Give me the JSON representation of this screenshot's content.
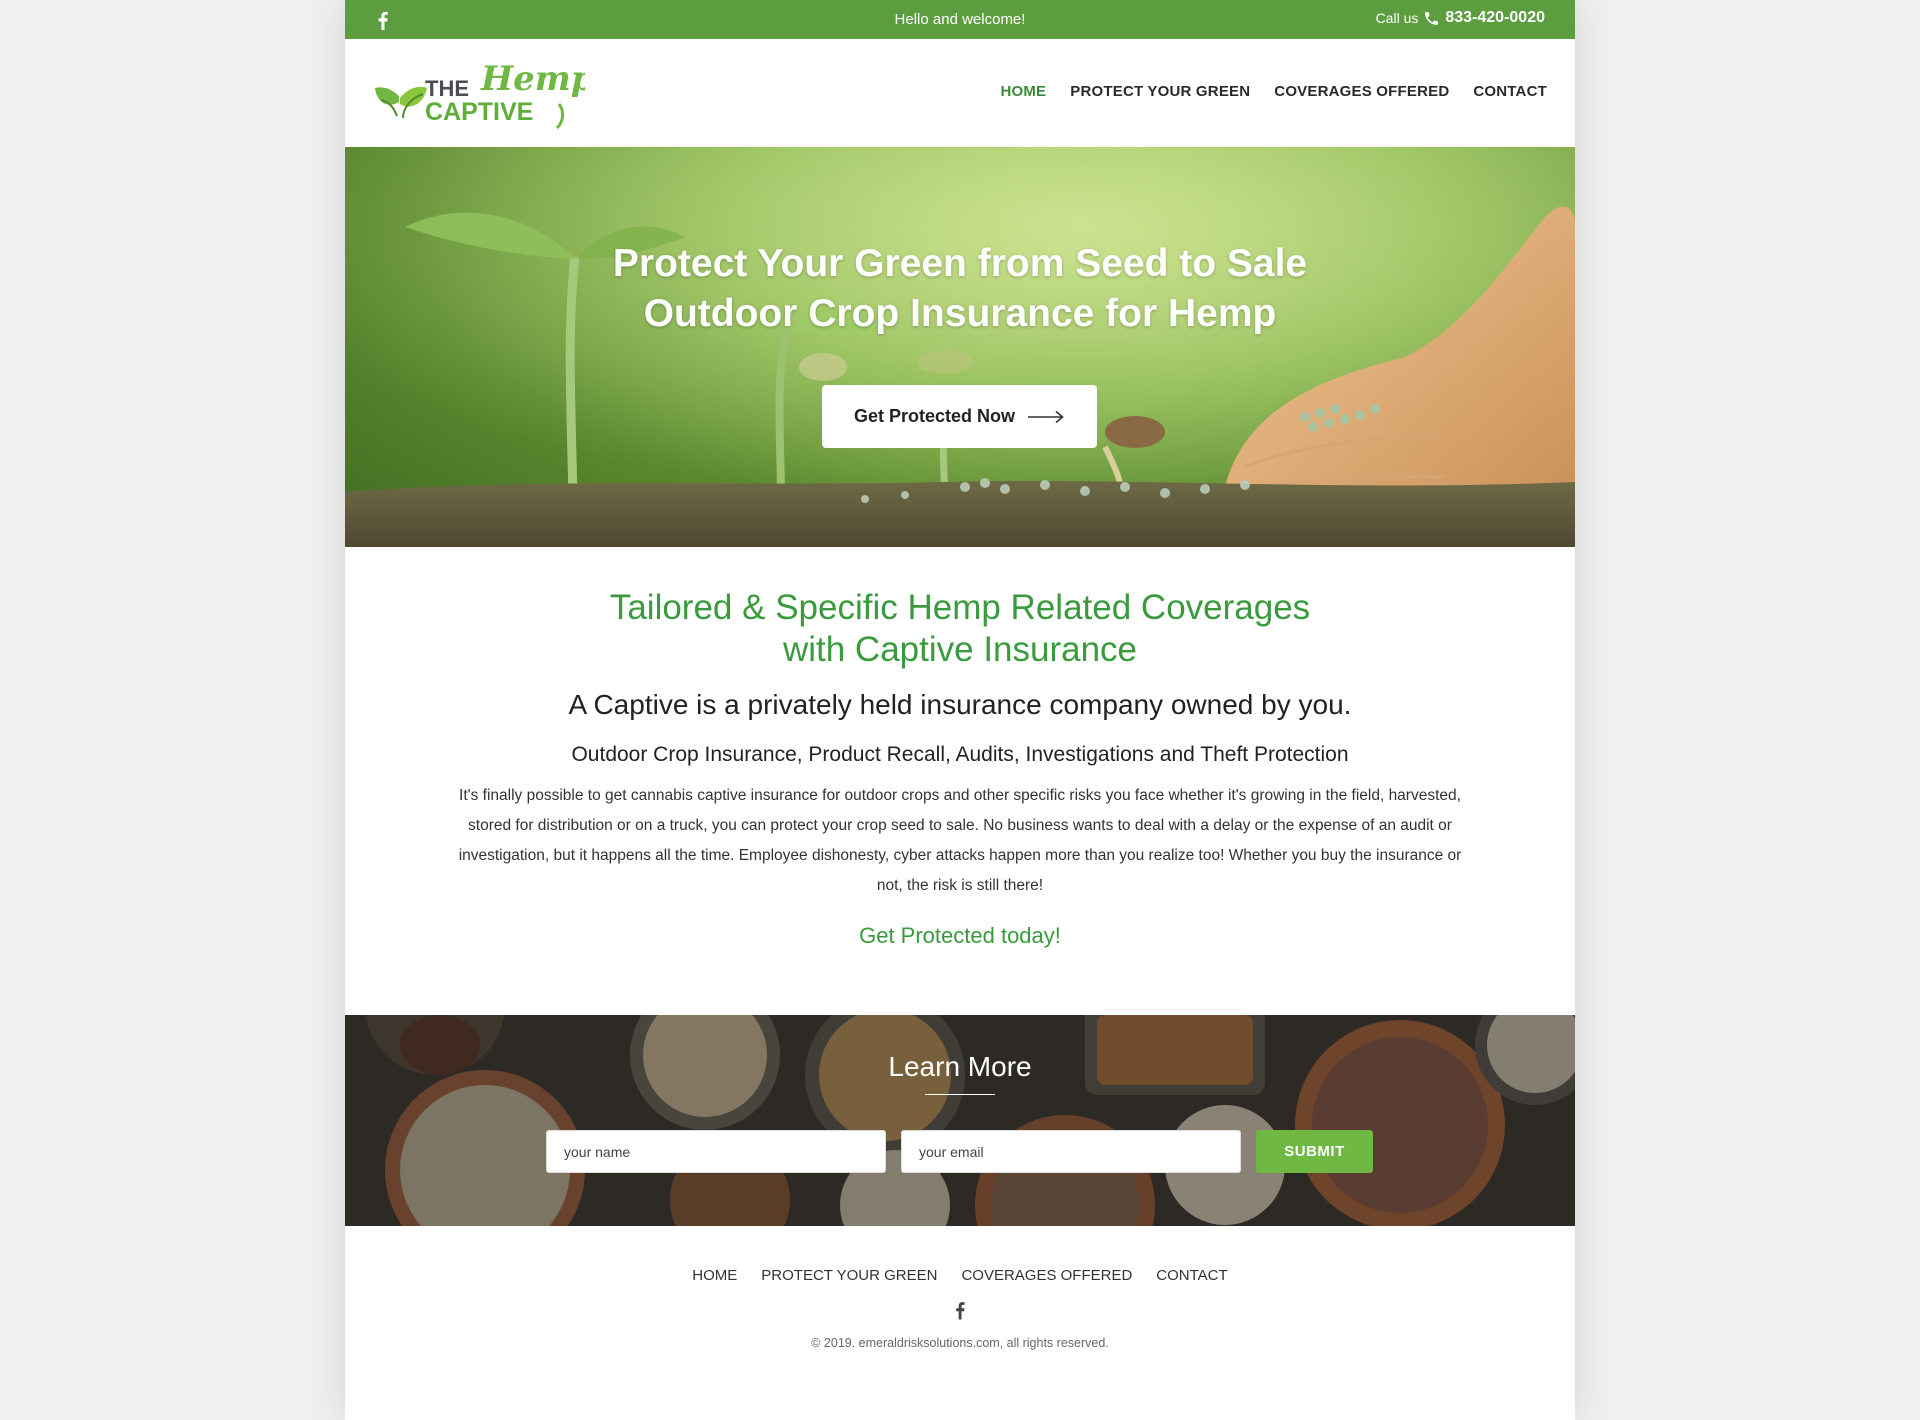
{
  "topbar": {
    "welcome": "Hello and welcome!",
    "call_label": "Call us",
    "phone": "833-420-0020"
  },
  "logo": {
    "the": "THE",
    "hemp": "Hemp",
    "captive": "CAPTIVE"
  },
  "nav": {
    "items": [
      {
        "label": "HOME",
        "active": true
      },
      {
        "label": "PROTECT YOUR GREEN",
        "active": false
      },
      {
        "label": "COVERAGES OFFERED",
        "active": false
      },
      {
        "label": "CONTACT",
        "active": false
      }
    ]
  },
  "hero": {
    "title_line1": "Protect Your Green from Seed to Sale",
    "title_line2": "Outdoor Crop Insurance for Hemp",
    "cta_label": "Get Protected Now"
  },
  "content": {
    "heading_line1": "Tailored & Specific Hemp Related Coverages",
    "heading_line2": "with Captive Insurance",
    "lead": "A Captive is a privately held insurance company owned by you.",
    "sub": "Outdoor Crop Insurance, Product Recall, Audits, Investigations and Theft Protection",
    "body": "It's finally possible to get cannabis captive insurance for outdoor crops and other specific risks you face whether it's growing in the field, harvested, stored for distribution or on a truck, you can protect your crop seed to sale. No business wants to deal with a delay or the expense of an audit or investigation, but it happens all the time. Employee dishonesty, cyber attacks happen more than you realize too! Whether you buy the insurance or not, the risk is still there!",
    "today": "Get Protected today!"
  },
  "learn_more": {
    "title": "Learn More",
    "name_placeholder": "your name",
    "email_placeholder": "your email",
    "submit_label": "SUBMIT"
  },
  "footer": {
    "nav": [
      "HOME",
      "PROTECT YOUR GREEN",
      "COVERAGES OFFERED",
      "CONTACT"
    ],
    "copyright": "© 2019. emeraldrisksolutions.com, all rights reserved."
  },
  "colors": {
    "brand_green": "#5c9e3f",
    "heading_green": "#3a9a3e",
    "submit_green": "#6fb843"
  },
  "icons": {
    "social": "facebook-icon",
    "phone": "phone-icon",
    "cta": "arrow-right-icon"
  }
}
